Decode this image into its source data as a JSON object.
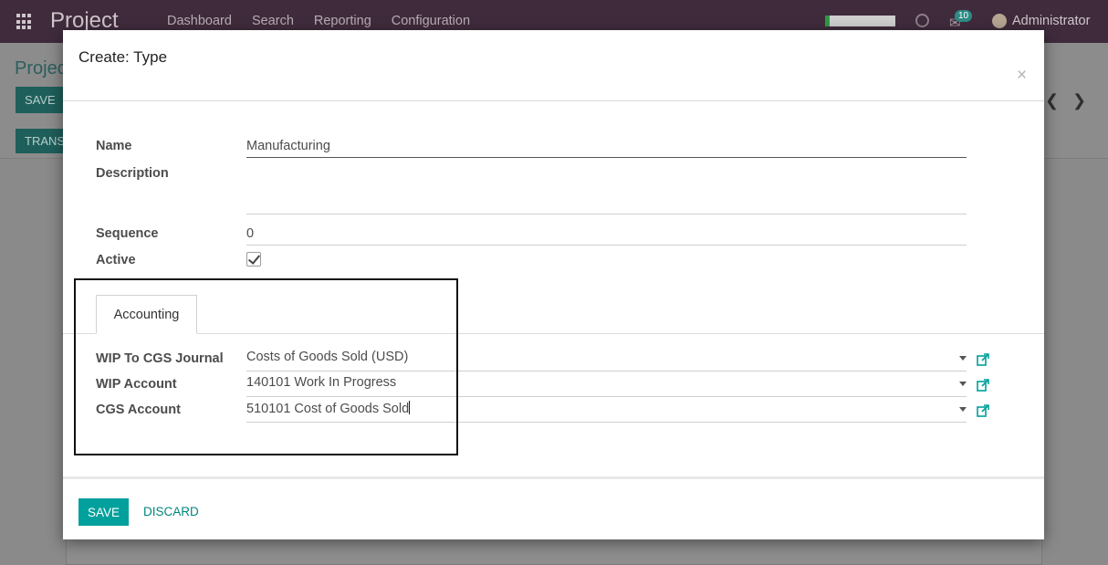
{
  "app": {
    "name": "Project",
    "menu": [
      "Dashboard",
      "Search",
      "Reporting",
      "Configuration"
    ],
    "notification_count": "10",
    "user": "Administrator"
  },
  "background": {
    "title_fragment": "Projec",
    "save_label": "SAVE",
    "trans_label": "TRANS"
  },
  "modal": {
    "title": "Create: Type",
    "close_glyph": "×",
    "fields": {
      "name": {
        "label": "Name",
        "value": "Manufacturing"
      },
      "description": {
        "label": "Description",
        "value": ""
      },
      "sequence": {
        "label": "Sequence",
        "value": "0"
      },
      "active": {
        "label": "Active",
        "checked": true
      }
    },
    "tabs": [
      {
        "label": "Accounting",
        "active": true
      }
    ],
    "accounting": {
      "wip_to_cgs_journal": {
        "label": "WIP To CGS Journal",
        "value": "Costs of Goods Sold (USD)"
      },
      "wip_account": {
        "label": "WIP Account",
        "value": "140101 Work In Progress"
      },
      "cgs_account": {
        "label": "CGS Account",
        "value": "510101 Cost of Goods Sold"
      }
    },
    "footer": {
      "save_label": "SAVE",
      "discard_label": "DISCARD"
    }
  },
  "colors": {
    "topbar": "#3f2b3c",
    "primary": "#00a09d",
    "link": "#00867e"
  }
}
